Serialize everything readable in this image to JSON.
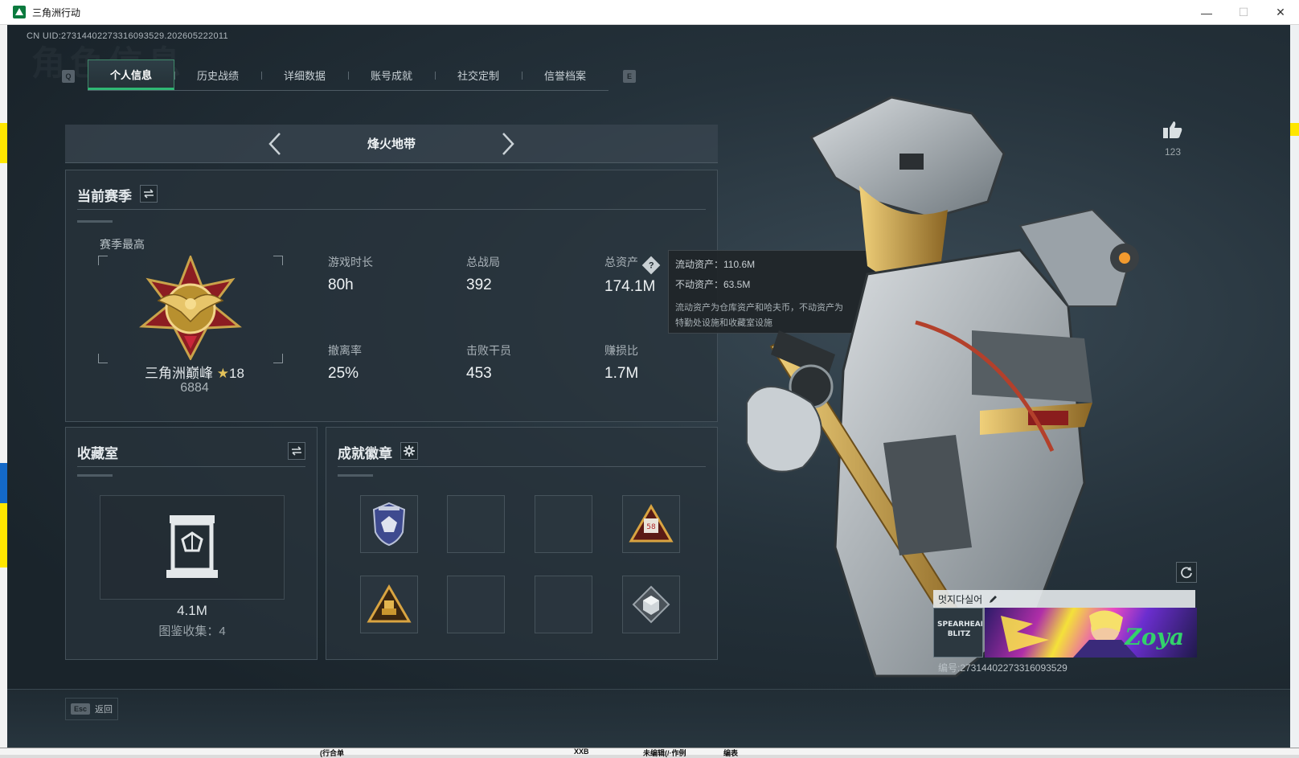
{
  "window": {
    "title": "三角洲行动",
    "minimize": "—",
    "maximize": "☐",
    "close": "✕"
  },
  "uid": "CN UID:27314402273316093529.202605222011",
  "ghost_title": "角色信息",
  "keys": {
    "prev_tab": "Q",
    "next_tab": "E"
  },
  "tabs": [
    {
      "label": "个人信息",
      "active": true
    },
    {
      "label": "历史战绩"
    },
    {
      "label": "详细数据"
    },
    {
      "label": "账号成就"
    },
    {
      "label": "社交定制"
    },
    {
      "label": "信誉档案"
    }
  ],
  "map": {
    "name": "烽火地带"
  },
  "season": {
    "title": "当前赛季",
    "best_label": "赛季最高",
    "rank_name": "三角洲巅峰",
    "rank_stars": "18",
    "rank_score": "6884",
    "stats": [
      {
        "label": "游戏时长",
        "value": "80h"
      },
      {
        "label": "总战局",
        "value": "392"
      },
      {
        "label": "总资产",
        "value": "174.1M",
        "help": "?"
      },
      {
        "label": "撤离率",
        "value": "25%"
      },
      {
        "label": "击败干员",
        "value": "453"
      },
      {
        "label": "赚损比",
        "value": "1.7M"
      }
    ]
  },
  "tooltip": {
    "liquid": "流动资产：110.6M",
    "fixed": "不动资产：63.5M",
    "desc_1": "流动资产为仓库资产和哈夫币，不动资产为",
    "desc_2": "特勤处设施和收藏室设施"
  },
  "vault": {
    "title": "收藏室",
    "value": "4.1M",
    "collection": "图鉴收集：4"
  },
  "achievements": {
    "title": "成就徽章",
    "slots": [
      "shield-badge",
      "",
      "",
      "warning-58-badge",
      "gold-triangle-badge",
      "",
      "",
      "cube-badge"
    ],
    "badge_58": "58"
  },
  "footer": {
    "esc_key": "Esc",
    "esc_label": "返回"
  },
  "likes": {
    "count": "123"
  },
  "namecard": {
    "nickname": "멋지다실어",
    "card_id": "编号:27314402273316093529",
    "emblem_text": "SPEARHEAD BLITZ",
    "banner_text": "Zoya"
  },
  "bottom_strip": [
    "(行合单",
    "XXB",
    "未编辑(/·作例",
    "编表"
  ],
  "colors": {
    "accent": "#2fb874",
    "panel": "#28333b",
    "text": "#e5eaed"
  }
}
